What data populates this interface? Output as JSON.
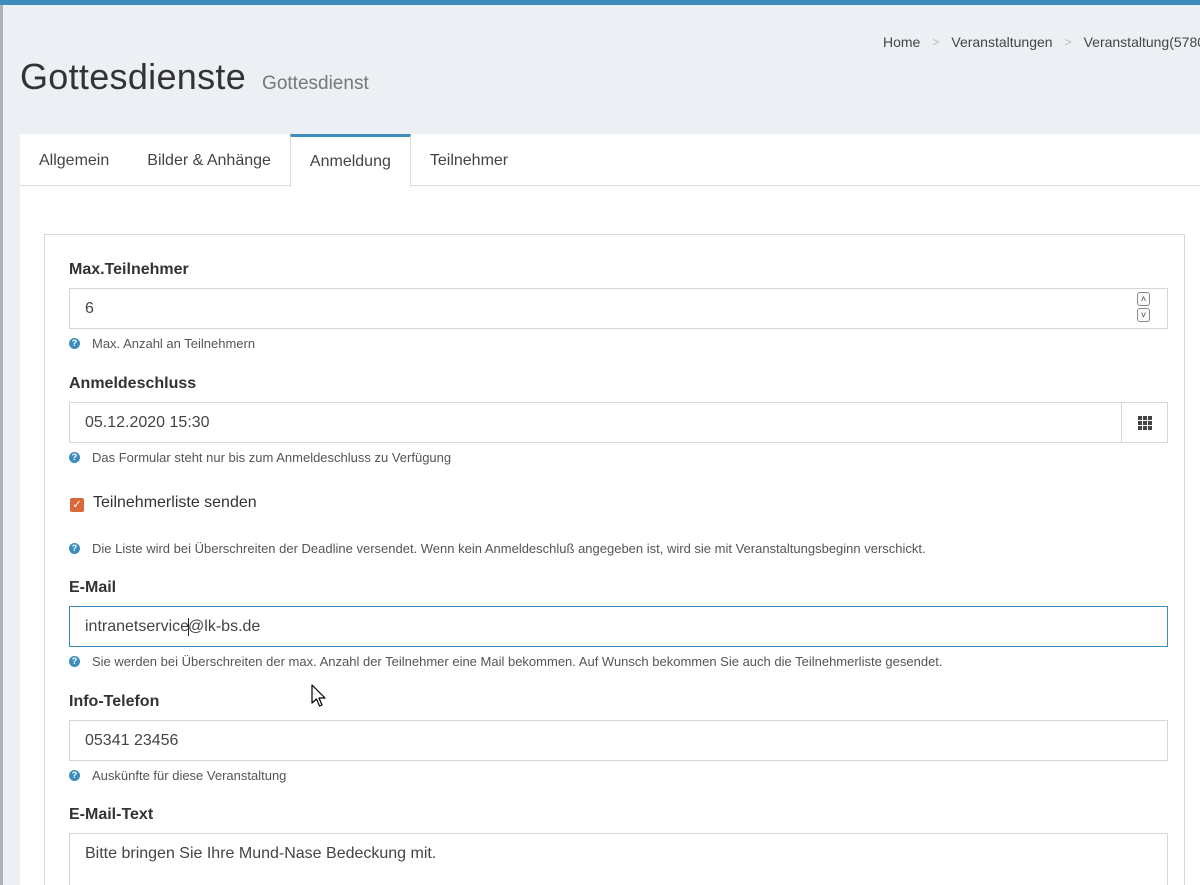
{
  "breadcrumb": [
    "Home",
    "Veranstaltungen",
    "Veranstaltung(5780"
  ],
  "header": {
    "title": "Gottesdienste",
    "subtitle": "Gottesdienst"
  },
  "tabs": [
    {
      "label": "Allgemein"
    },
    {
      "label": "Bilder & Anhänge"
    },
    {
      "label": "Anmeldung"
    },
    {
      "label": "Teilnehmer"
    }
  ],
  "form": {
    "max_participants": {
      "label": "Max.Teilnehmer",
      "value": "6",
      "help": "Max. Anzahl an Teilnehmern"
    },
    "deadline": {
      "label": "Anmeldeschluss",
      "value": "05.12.2020 15:30",
      "help": "Das Formular steht nur bis zum Anmeldeschluss zu Verfügung"
    },
    "send_list": {
      "label": "Teilnehmerliste senden",
      "checked": true,
      "help": "Die Liste wird bei Überschreiten der Deadline versendet. Wenn kein Anmeldeschluß angegeben ist, wird sie mit Veranstaltungsbeginn verschickt."
    },
    "email": {
      "label": "E-Mail",
      "value_before_caret": "intranetservice",
      "value_after_caret": "@lk-bs.de",
      "help": "Sie werden bei Überschreiten der max. Anzahl der Teilnehmer eine Mail bekommen. Auf Wunsch bekommen Sie auch die Teilnehmerliste gesendet."
    },
    "phone": {
      "label": "Info-Telefon",
      "value": "05341 23456",
      "help": "Auskünfte für diese Veranstaltung"
    },
    "email_text": {
      "label": "E-Mail-Text",
      "value": "Bitte bringen Sie Ihre Mund-Nase Bedeckung mit."
    }
  },
  "icons": {
    "help": "question-circle-icon",
    "calendar": "grid-calendar-icon",
    "spinner_up": "chevron-up-icon",
    "spinner_down": "chevron-down-icon",
    "checkbox": "check-icon"
  },
  "colors": {
    "accent": "#3c8dbc",
    "checkbox": "#d9683a",
    "background": "#ecf0f5"
  }
}
